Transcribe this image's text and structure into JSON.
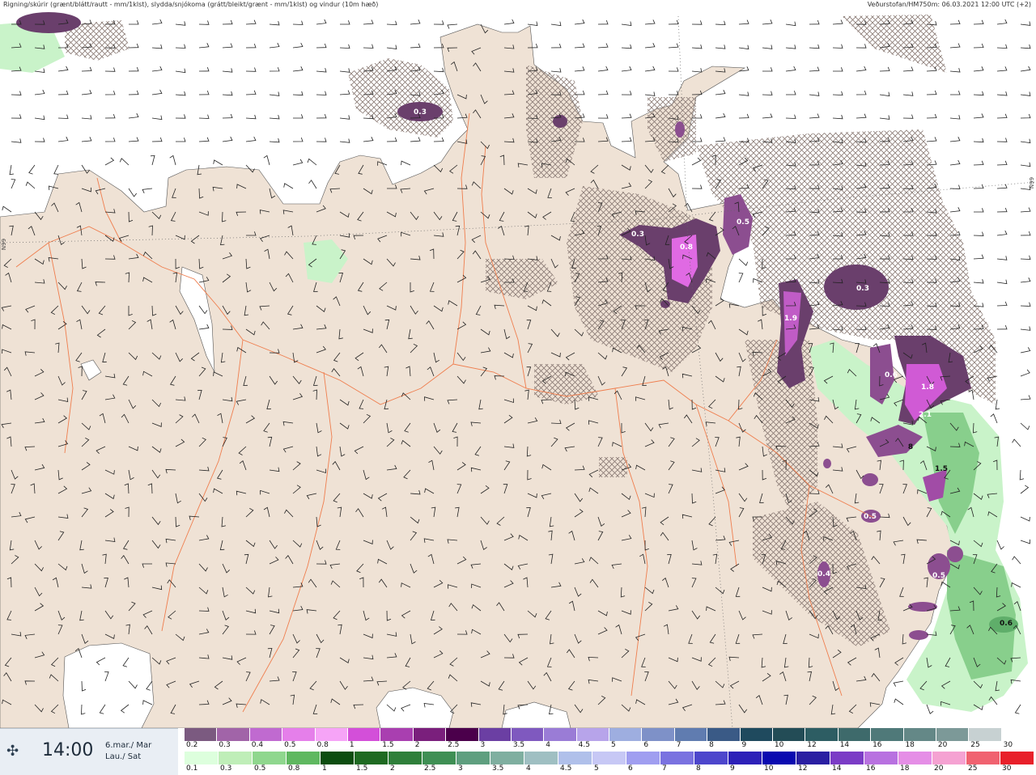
{
  "header": {
    "left": "Rigning/skúrir (grænt/blátt/rautt - mm/1klst), slydda/snjókoma (grátt/bleikt/grænt - mm/1klst) og vindur (10m hæð)",
    "right": "Veðurstofan/HM750m: 06.03.2021 12:00 UTC (+2)"
  },
  "lat_labels": [
    "N99",
    "N99"
  ],
  "map_values": [
    {
      "text": "0.3",
      "dark": false
    },
    {
      "text": "0.3",
      "dark": false
    },
    {
      "text": "0.8",
      "dark": false
    },
    {
      "text": "0.5",
      "dark": false
    },
    {
      "text": "0.3",
      "dark": false
    },
    {
      "text": "1.9",
      "dark": false
    },
    {
      "text": "0.6",
      "dark": false
    },
    {
      "text": "1.8",
      "dark": false
    },
    {
      "text": "2.1",
      "dark": false
    },
    {
      "text": "8",
      "dark": true
    },
    {
      "text": "1.5",
      "dark": true
    },
    {
      "text": "0.6",
      "dark": true
    },
    {
      "text": "0.5",
      "dark": false
    },
    {
      "text": "0.4",
      "dark": false
    },
    {
      "text": "0.5",
      "dark": false
    }
  ],
  "time": {
    "icon": "wind-icon",
    "value": "14:00",
    "date_line1": "6.mar./ Mar",
    "date_line2": "Lau./ Sat"
  },
  "colors": {
    "land": "#efe2d5",
    "sea": "#ffffff",
    "snow_hatch": "#8a7a74",
    "purple_dark": "#6a3f6c",
    "purple_mid": "#a24aa8",
    "magenta": "#ef7cf0",
    "green_light": "#c9f3c9",
    "green_mid": "#88cf8c",
    "roads": "#ef7d4d"
  },
  "snow_scale": {
    "labels": [
      "0.2",
      "0.3",
      "0.4",
      "0.5",
      "0.8",
      "1",
      "1.5",
      "2",
      "2.5",
      "3",
      "3.5",
      "4",
      "4.5",
      "5",
      "6",
      "7",
      "8",
      "9",
      "10",
      "12",
      "14",
      "16",
      "18",
      "20",
      "25",
      "30"
    ],
    "colors": [
      "#7b5a80",
      "#a164a8",
      "#c06ad0",
      "#e57fea",
      "#f6a4f7",
      "#d34fd9",
      "#a93fb0",
      "#7a1f7c",
      "#4b004b",
      "#6b3fa3",
      "#7f59bf",
      "#9a7cd6",
      "#b7a4ea",
      "#9eaee0",
      "#7e91c8",
      "#607cb0",
      "#3a5a86",
      "#1f4a5e",
      "#234c56",
      "#2d5d63",
      "#3e6a6b",
      "#4f7979",
      "#648887",
      "#7c9998",
      "#c7d1d2",
      "#ffffff"
    ]
  },
  "rain_scale": {
    "labels": [
      "0.1",
      "0.3",
      "0.5",
      "0.8",
      "1",
      "1.5",
      "2",
      "2.5",
      "3",
      "3.5",
      "4",
      "4.5",
      "5",
      "6",
      "7",
      "8",
      "9",
      "10",
      "12",
      "14",
      "16",
      "18",
      "20",
      "25",
      "30"
    ],
    "colors": [
      "#ddffdd",
      "#bfeeb8",
      "#8fd78e",
      "#5fb860",
      "#0d4d10",
      "#1f6a22",
      "#2f7f3a",
      "#3f8f54",
      "#5f9f7f",
      "#7fafa0",
      "#9fbfc2",
      "#b0c0ea",
      "#c7c8f5",
      "#a09ef0",
      "#7a72e0",
      "#4d46cc",
      "#2d21b8",
      "#0a0ab0",
      "#2a1fa2",
      "#7b3cc6",
      "#b871e0",
      "#e58ee6",
      "#f5a2d2",
      "#f06270",
      "#e8202a"
    ]
  }
}
